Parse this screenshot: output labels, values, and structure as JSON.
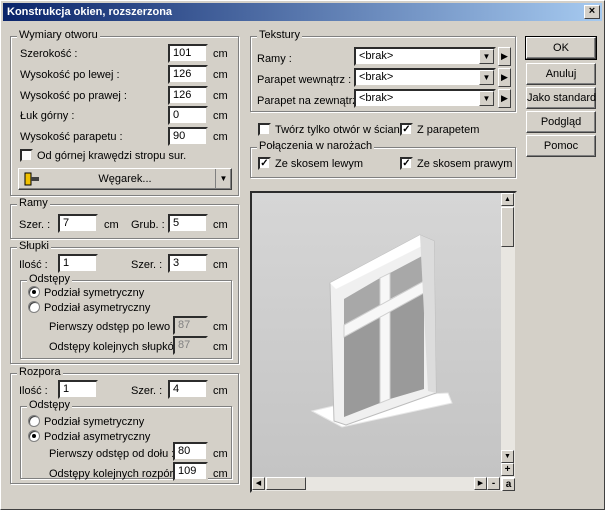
{
  "window": {
    "title": "Konstrukcja okien, rozszerzona",
    "close": "×"
  },
  "dims": {
    "title": "Wymiary otworu",
    "rows": [
      {
        "label": "Szerokość :",
        "value": "101",
        "unit": "cm"
      },
      {
        "label": "Wysokość po lewej :",
        "value": "126",
        "unit": "cm"
      },
      {
        "label": "Wysokość po prawej :",
        "value": "126",
        "unit": "cm"
      },
      {
        "label": "Łuk górny :",
        "value": "0",
        "unit": "cm"
      },
      {
        "label": "Wysokość parapetu :",
        "value": "90",
        "unit": "cm"
      }
    ],
    "from_top": "Od górnej krawędzi stropu sur.",
    "wegarek": "Węgarek..."
  },
  "ramy": {
    "title": "Ramy",
    "szer_label": "Szer. :",
    "szer": "7",
    "grub_label": "Grub. :",
    "grub": "5",
    "unit": "cm"
  },
  "slupki": {
    "title": "Słupki",
    "ilosc_label": "Ilość :",
    "ilosc": "1",
    "szer_label": "Szer. :",
    "szer": "3",
    "unit": "cm",
    "odstepy": "Odstępy",
    "sym": "Podział symetryczny",
    "asym": "Podział asymetryczny",
    "first_label": "Pierwszy odstęp po lewo :",
    "first": "87",
    "next_label": "Odstępy kolejnych słupków :",
    "next": "87"
  },
  "rozpora": {
    "title": "Rozpora",
    "ilosc_label": "Ilość :",
    "ilosc": "1",
    "szer_label": "Szer. :",
    "szer": "4",
    "unit": "cm",
    "odstepy": "Odstępy",
    "sym": "Podział symetryczny",
    "asym": "Podział asymetryczny",
    "first_label": "Pierwszy odstęp od dołu :",
    "first": "80",
    "next_label": "Odstępy kolejnych rozpór :",
    "next": "109"
  },
  "tekstury": {
    "title": "Tekstury",
    "rows": [
      {
        "label": "Ramy :",
        "value": "<brak>"
      },
      {
        "label": "Parapet wewnątrz :",
        "value": "<brak>"
      },
      {
        "label": "Parapet na zewnątrz :",
        "value": "<brak>"
      }
    ]
  },
  "options": {
    "only_hole": "Twórz tylko otwór w ścianie",
    "with_sill": "Z parapetem"
  },
  "corners": {
    "title": "Połączenia w narożach",
    "left": "Ze skosem lewym",
    "right": "Ze skosem prawym"
  },
  "buttons": {
    "ok": "OK",
    "cancel": "Anuluj",
    "standard": "Jako standard",
    "preview": "Podgląd",
    "help": "Pomoc"
  },
  "zoom": {
    "plus": "+",
    "minus": "-",
    "a": "a"
  }
}
